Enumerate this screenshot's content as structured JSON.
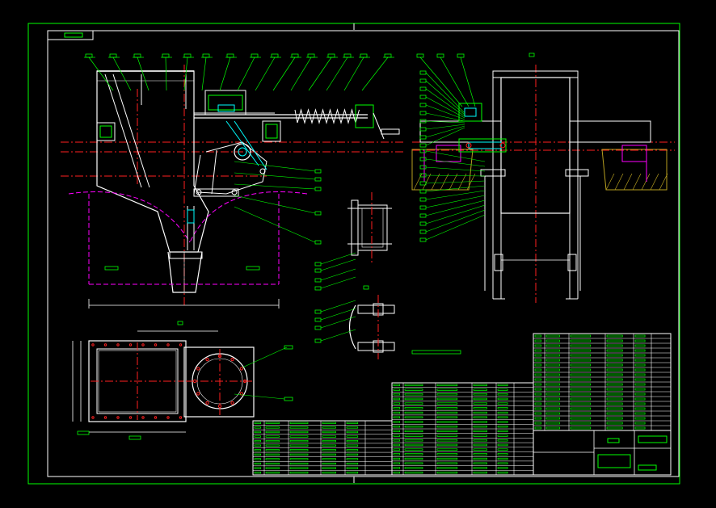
{
  "drawing": {
    "background": "#000000",
    "colors": {
      "outline": "#ffffff",
      "leader": "#00ff00",
      "center": "#ff2020",
      "hidden": "#ff00ff",
      "highlight": "#00ffff",
      "fill_section": "#b8a020",
      "label_box": "#00ff00"
    },
    "views": [
      "front-elevation",
      "side-elevation",
      "gate-top-view",
      "bracket-detail-a",
      "bracket-detail-b"
    ],
    "tables": [
      "parts-list-left",
      "parts-list-middle",
      "parts-list-right",
      "title-block"
    ]
  }
}
